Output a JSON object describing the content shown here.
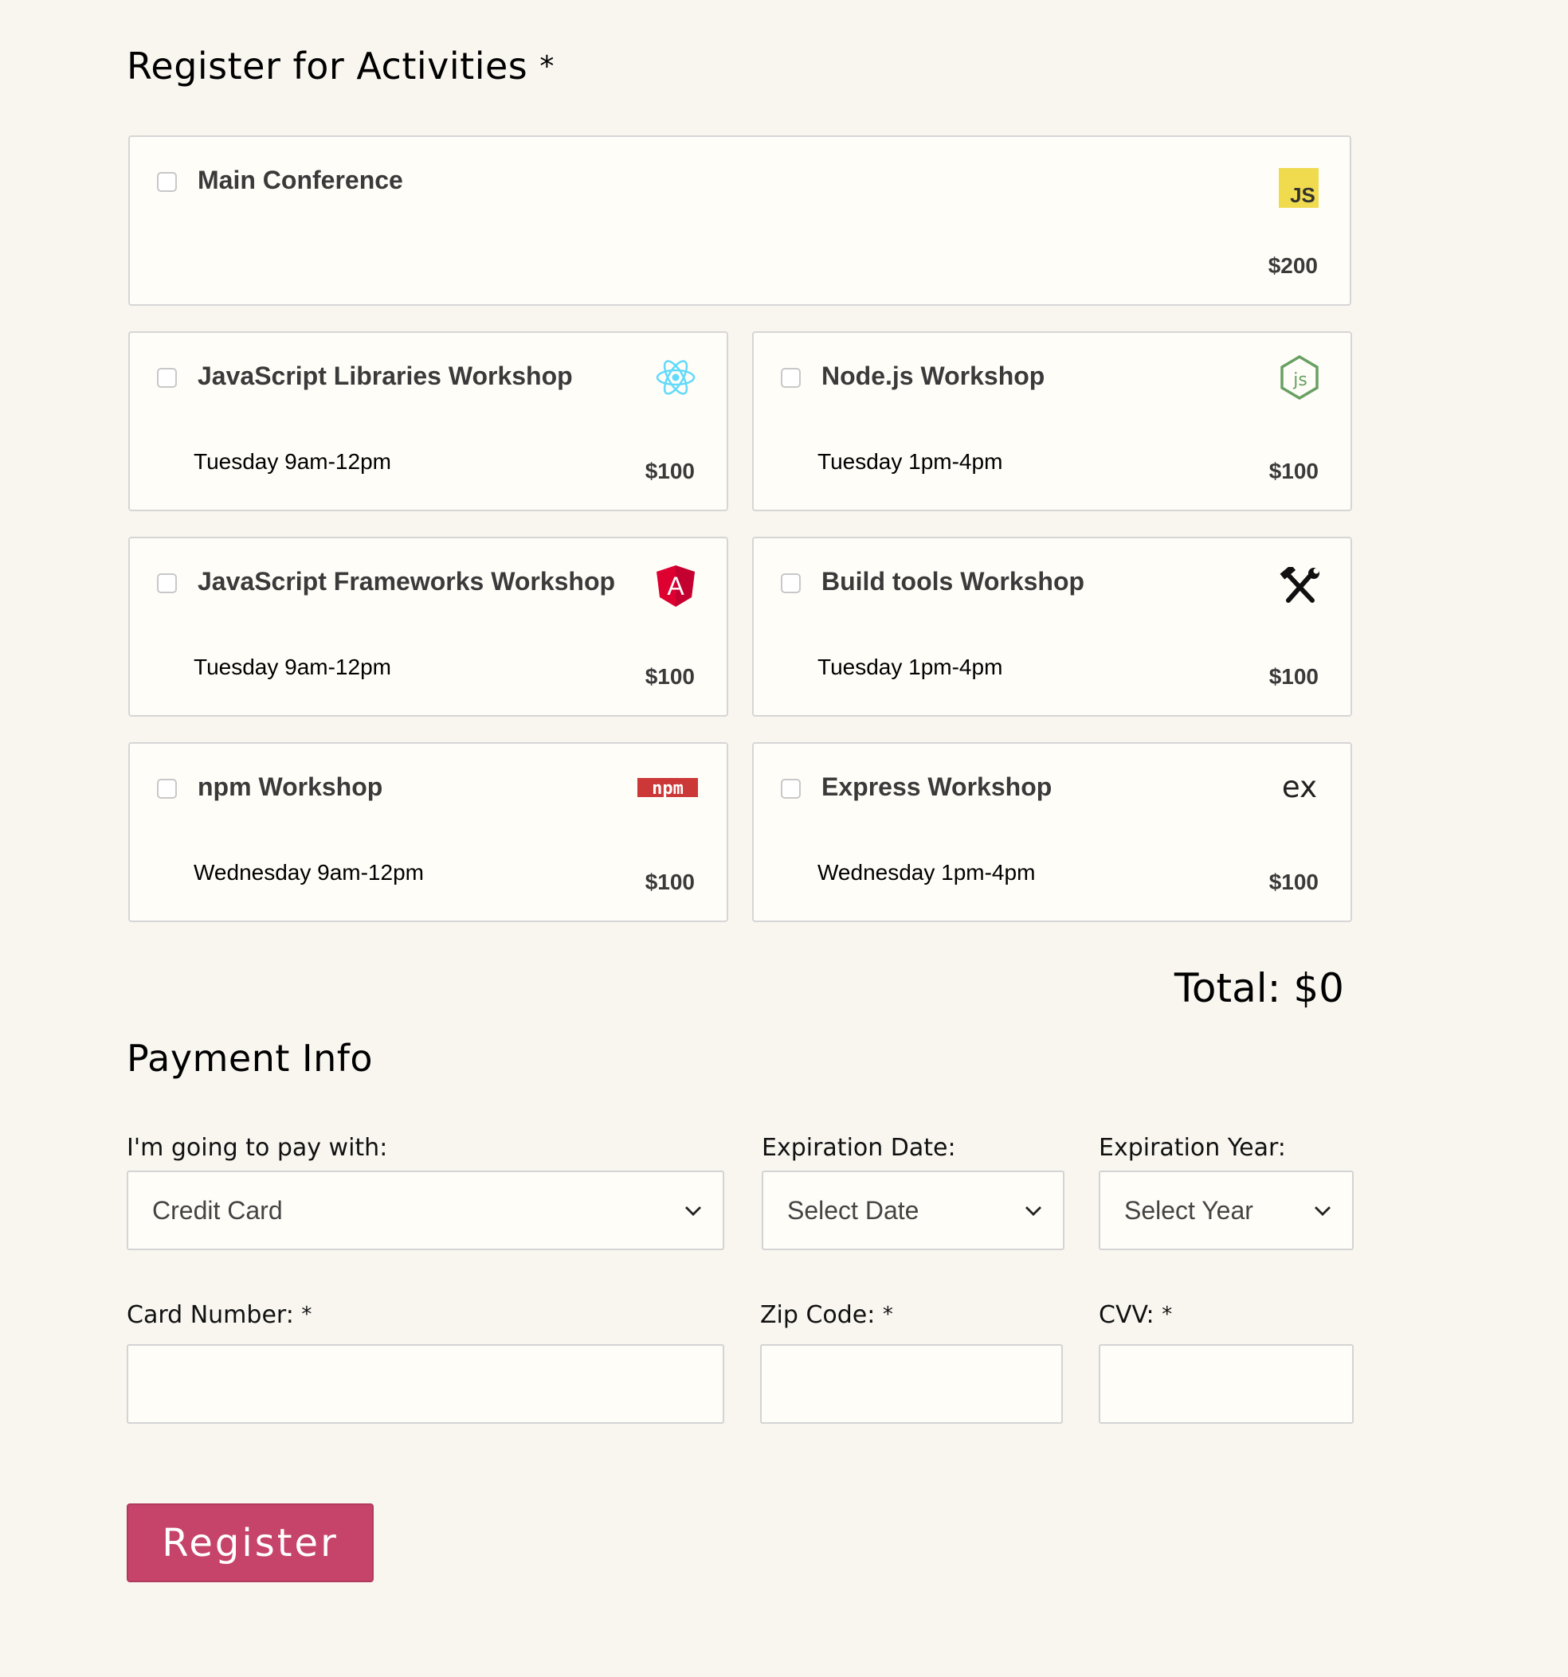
{
  "activities": {
    "heading": "Register for Activities",
    "required_mark": "*",
    "items": [
      {
        "name": "Main Conference",
        "time": "",
        "price": "$200",
        "icon": "javascript-icon"
      },
      {
        "name": "JavaScript Libraries Workshop",
        "time": "Tuesday 9am-12pm",
        "price": "$100",
        "icon": "react-icon"
      },
      {
        "name": "Node.js Workshop",
        "time": "Tuesday 1pm-4pm",
        "price": "$100",
        "icon": "nodejs-icon"
      },
      {
        "name": "JavaScript Frameworks Workshop",
        "time": "Tuesday 9am-12pm",
        "price": "$100",
        "icon": "angular-icon"
      },
      {
        "name": "Build tools Workshop",
        "time": "Tuesday 1pm-4pm",
        "price": "$100",
        "icon": "hammer-wrench-icon"
      },
      {
        "name": "npm Workshop",
        "time": "Wednesday 9am-12pm",
        "price": "$100",
        "icon": "npm-icon"
      },
      {
        "name": "Express Workshop",
        "time": "Wednesday 1pm-4pm",
        "price": "$100",
        "icon": "express-icon"
      }
    ],
    "total": "Total: $0"
  },
  "icon_text": {
    "js": "JS",
    "angular": "A",
    "npm": "npm",
    "express": "ex"
  },
  "payment": {
    "heading": "Payment Info",
    "pay_with_label": "I'm going to pay with:",
    "pay_with_value": "Credit Card",
    "exp_date_label": "Expiration Date:",
    "exp_date_value": "Select Date",
    "exp_year_label": "Expiration Year:",
    "exp_year_value": "Select Year",
    "card_number_label": "Card Number:",
    "zip_label": "Zip Code:",
    "cvv_label": "CVV:",
    "required_mark": "*",
    "card_number_value": "",
    "zip_value": "",
    "cvv_value": ""
  },
  "register_button": "Register",
  "colors": {
    "background": "#f9f6f0",
    "card_background": "#fffdf8",
    "button": "#c6436a",
    "js_yellow": "#f0db4f",
    "react_blue": "#61dafb",
    "node_green": "#68a063",
    "angular_red": "#dd0031",
    "npm_red": "#cb3837"
  }
}
